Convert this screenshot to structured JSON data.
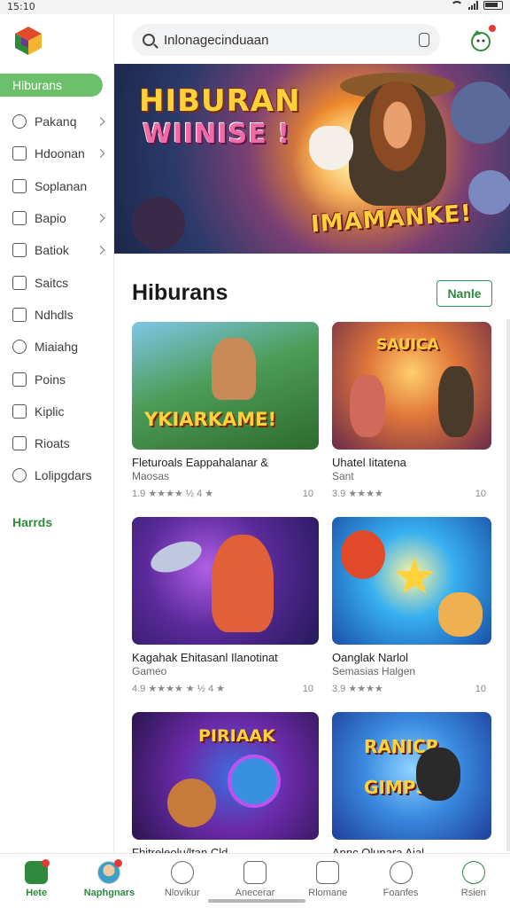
{
  "status_bar": {
    "time": "15:10"
  },
  "sidebar": {
    "items": [
      {
        "label": "Hiburans",
        "active": true,
        "chevron": false
      },
      {
        "label": "Pakanq",
        "chevron": true
      },
      {
        "label": "Hdoonan",
        "chevron": true
      },
      {
        "label": "Soplanan",
        "chevron": false
      },
      {
        "label": "Bapio",
        "chevron": true
      },
      {
        "label": "Batiok",
        "chevron": true
      },
      {
        "label": "Saitcs",
        "chevron": false
      },
      {
        "label": "Ndhdls",
        "chevron": false
      },
      {
        "label": "Miaiahg",
        "chevron": false
      },
      {
        "label": "Poins",
        "chevron": false
      },
      {
        "label": "Kiplic",
        "chevron": false
      },
      {
        "label": "Rioats",
        "chevron": false
      },
      {
        "label": "Lolipgdars",
        "chevron": false
      }
    ],
    "section_label": "Harrds"
  },
  "search": {
    "value": "Inlonagecinduaan"
  },
  "hero": {
    "line1": "HIBURAN",
    "line2": "WIINISE !",
    "line3": "IMAMANKE!"
  },
  "section": {
    "title": "Hiburans",
    "more_label": "Nanle"
  },
  "cards": [
    {
      "art": "YKIARKAME!",
      "title": "Fleturoals Eappahalanar &",
      "subtitle": "Maosas",
      "meta": "1.9 ★★★★ ½ 4 ★",
      "num": "10"
    },
    {
      "art": "SAUICA",
      "title": "Uhatel Iitatena",
      "subtitle": "Sant",
      "meta": "3.9 ★★★★",
      "num": "10"
    },
    {
      "art": "",
      "title": "Kagahak Ehitasanl Ilanotinat",
      "subtitle": "Gameo",
      "meta": "4.9 ★★★★ ★ ½ 4 ★",
      "num": "10"
    },
    {
      "art": "",
      "title": "Oanglak Narlol",
      "subtitle": "Semasias Halgen",
      "meta": "3.9 ★★★★",
      "num": "10"
    },
    {
      "art": "PIRIAAK",
      "title": "Fhitreleolu/ltan Cld",
      "subtitle": "",
      "meta": "",
      "num": ""
    },
    {
      "art": "RANICR GIMPS",
      "title": "Annc Olunara Aial",
      "subtitle": "",
      "meta": "",
      "num": ""
    }
  ],
  "bottom_nav": [
    {
      "label": "Hete",
      "active": true
    },
    {
      "label": "Naphgnars",
      "active": true
    },
    {
      "label": "Nlovikur",
      "active": false
    },
    {
      "label": "Anecerar",
      "active": false
    },
    {
      "label": "Rlomane",
      "active": false
    },
    {
      "label": "Foanfes",
      "active": false
    },
    {
      "label": "Rsien",
      "active": false
    }
  ],
  "colors": {
    "accent": "#2e8b3e",
    "accent_light": "#6cc06a",
    "badge": "#e53935"
  }
}
